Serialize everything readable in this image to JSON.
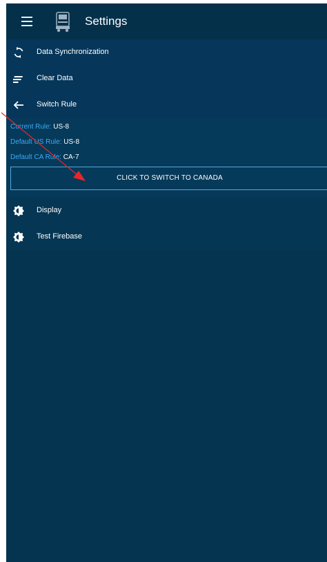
{
  "header": {
    "title": "Settings",
    "menu_icon": "hamburger-menu-icon",
    "app_icon": "truck-icon"
  },
  "menu": {
    "items": [
      {
        "label": "Data Synchronization",
        "icon": "sync-icon"
      },
      {
        "label": "Clear Data",
        "icon": "clear-data-icon"
      },
      {
        "label": "Switch Rule",
        "icon": "back-arrow-icon"
      }
    ]
  },
  "rules": {
    "current_label": "Current Rule:",
    "current_value": "US-8",
    "default_us_label": "Default US Rule:",
    "default_us_value": "US-8",
    "default_ca_label": "Default CA Rule:",
    "default_ca_value": "CA-7",
    "switch_button_label": "CLICK TO SWITCH TO CANADA"
  },
  "menu_bottom": {
    "items": [
      {
        "label": "Display",
        "icon": "brightness-icon"
      },
      {
        "label": "Test Firebase",
        "icon": "brightness-icon"
      }
    ]
  },
  "colors": {
    "background": "#04344f",
    "toolbar": "#05304a",
    "accent_text": "#3fa9f5",
    "button_border": "#57a8e0",
    "annotation_arrow": "#e8262a"
  }
}
